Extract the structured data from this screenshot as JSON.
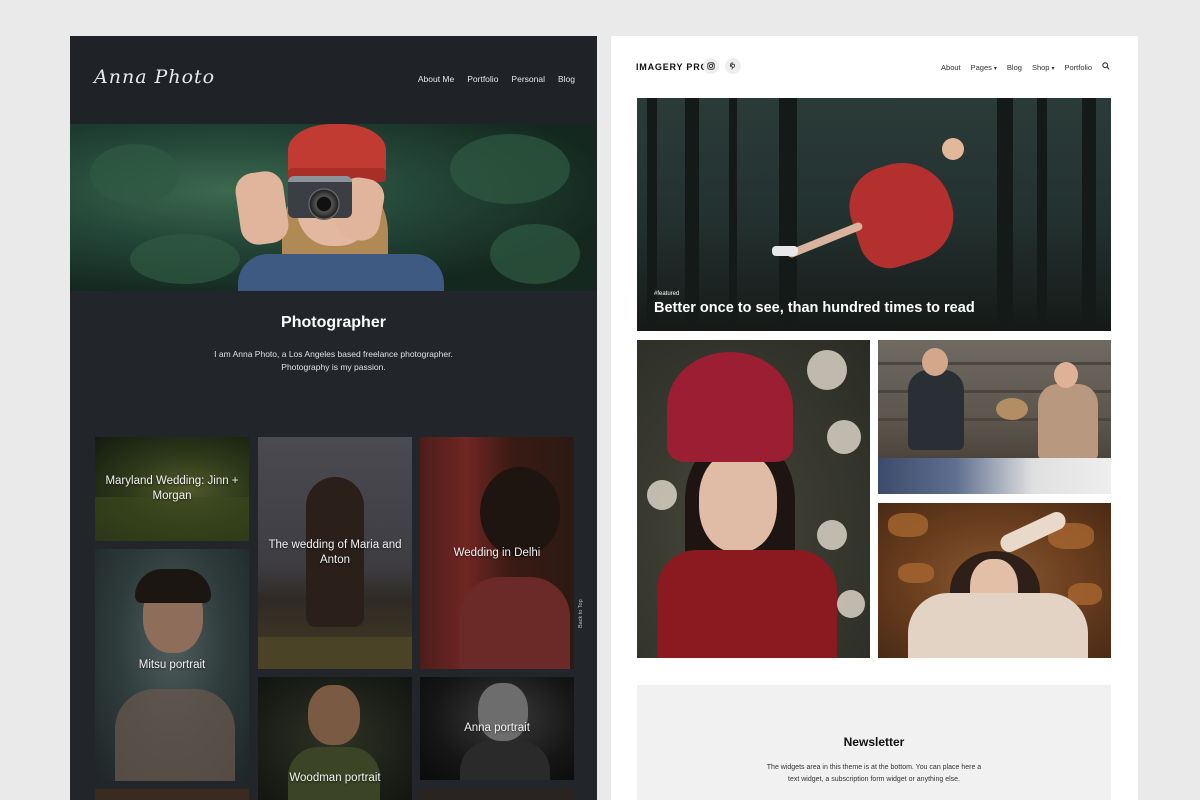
{
  "left_theme": {
    "logo": "Anna Photo",
    "nav": [
      "About Me",
      "Portfolio",
      "Personal",
      "Blog"
    ],
    "heading": "Photographer",
    "intro_line1": "I am Anna Photo, a Los Angeles based freelance photographer.",
    "intro_line2": "Photography is my passion.",
    "tiles": {
      "maryland": "Maryland Wedding: Jinn + Morgan",
      "maria": "The wedding of Maria and Anton",
      "delhi": "Wedding in Delhi",
      "mitsu": "Mitsu portrait",
      "woodman": "Woodman portrait",
      "anna": "Anna portrait"
    },
    "back_to_top": "Back to Top"
  },
  "right_theme": {
    "brand": "IMAGERY PRO",
    "social_icons": [
      "instagram-icon",
      "pinterest-icon"
    ],
    "nav": {
      "about": "About",
      "pages": "Pages",
      "blog": "Blog",
      "shop": "Shop",
      "portfolio": "Portfolio"
    },
    "featured": {
      "tag": "#featured",
      "title": "Better once to see, than hundred times to read"
    },
    "newsletter": {
      "title": "Newsletter",
      "text_line1": "The widgets area in this theme is at the bottom. You can place here a",
      "text_line2": "text widget, a subscription form widget or anything else."
    }
  },
  "colors": {
    "dark_panel": "#22262b",
    "light_panel": "#ffffff",
    "page_background": "#eaeaea"
  }
}
